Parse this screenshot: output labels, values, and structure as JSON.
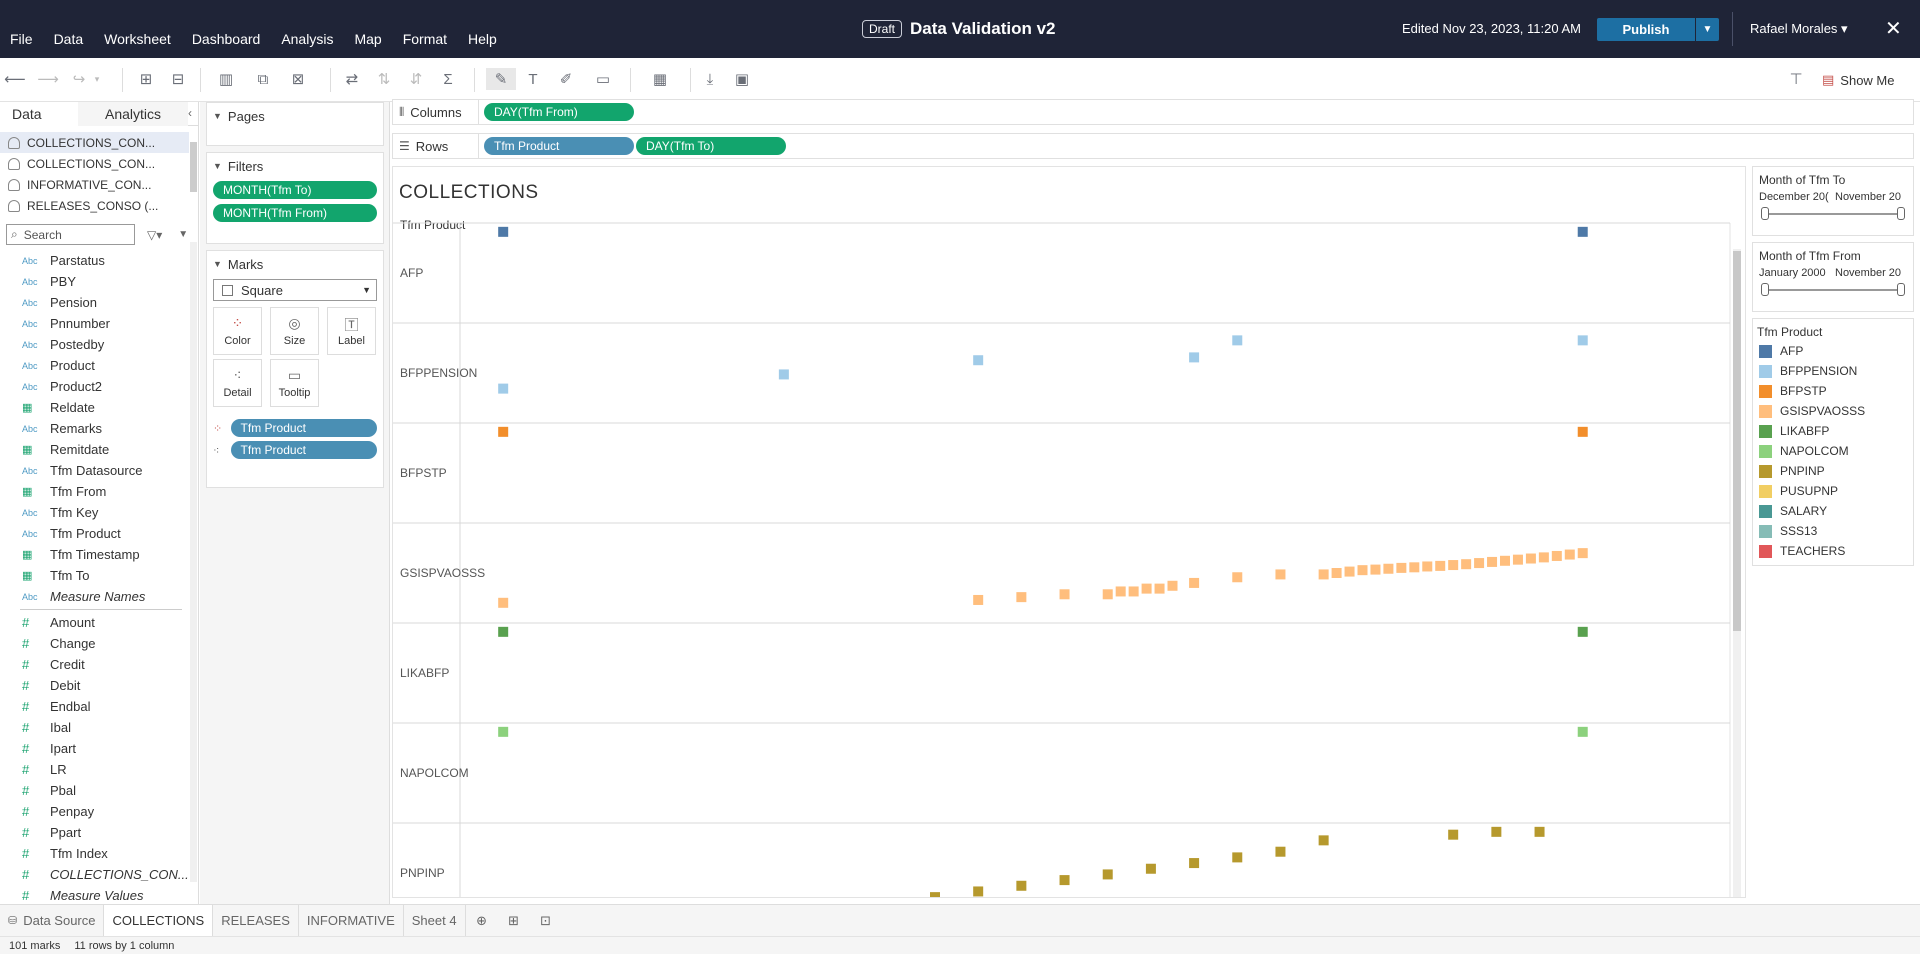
{
  "menu": [
    "File",
    "Data",
    "Worksheet",
    "Dashboard",
    "Analysis",
    "Map",
    "Format",
    "Help"
  ],
  "header": {
    "draft": "Draft",
    "title": "Data Validation v2",
    "edited": "Edited Nov 23, 2023, 11:20 AM",
    "publish": "Publish",
    "user": "Rafael Morales ▾",
    "close": "✕"
  },
  "toolbar": {
    "show_me": "Show Me"
  },
  "left_panel": {
    "tab_data": "Data",
    "tab_analytics": "Analytics",
    "datasources": [
      "COLLECTIONS_CON...",
      "COLLECTIONS_CON...",
      "INFORMATIVE_CON...",
      "RELEASES_CONSO (..."
    ],
    "search_placeholder": "Search",
    "dimensions": [
      {
        "type": "Abc",
        "name": "Parstatus"
      },
      {
        "type": "Abc",
        "name": "PBY"
      },
      {
        "type": "Abc",
        "name": "Pension"
      },
      {
        "type": "Abc",
        "name": "Pnnumber"
      },
      {
        "type": "Abc",
        "name": "Postedby"
      },
      {
        "type": "Abc",
        "name": "Product"
      },
      {
        "type": "Abc",
        "name": "Product2"
      },
      {
        "type": "date",
        "name": "Reldate"
      },
      {
        "type": "Abc",
        "name": "Remarks"
      },
      {
        "type": "date",
        "name": "Remitdate"
      },
      {
        "type": "Abc",
        "name": "Tfm Datasource"
      },
      {
        "type": "date",
        "name": "Tfm From"
      },
      {
        "type": "Abc",
        "name": "Tfm Key"
      },
      {
        "type": "Abc",
        "name": "Tfm Product"
      },
      {
        "type": "date",
        "name": "Tfm Timestamp"
      },
      {
        "type": "date",
        "name": "Tfm To"
      },
      {
        "type": "Abc",
        "name": "Measure Names",
        "italic": true
      }
    ],
    "measures": [
      {
        "name": "Amount"
      },
      {
        "name": "Change"
      },
      {
        "name": "Credit"
      },
      {
        "name": "Debit"
      },
      {
        "name": "Endbal"
      },
      {
        "name": "Ibal"
      },
      {
        "name": "Ipart"
      },
      {
        "name": "LR"
      },
      {
        "name": "Pbal"
      },
      {
        "name": "Penpay"
      },
      {
        "name": "Ppart"
      },
      {
        "name": "Tfm Index"
      },
      {
        "name": "COLLECTIONS_CON...",
        "italic": true
      },
      {
        "name": "Measure Values",
        "italic": true
      }
    ]
  },
  "cards": {
    "pages": "Pages",
    "filters": "Filters",
    "filter_pills": [
      "MONTH(Tfm To)",
      "MONTH(Tfm From)"
    ],
    "marks": "Marks",
    "mark_type": "Square",
    "mark_buttons": [
      "Color",
      "Size",
      "Label",
      "Detail",
      "Tooltip"
    ],
    "mark_pills": [
      "Tfm Product",
      "Tfm Product"
    ]
  },
  "shelves": {
    "columns_label": "Columns",
    "rows_label": "Rows",
    "columns": [
      "DAY(Tfm From)"
    ],
    "rows": [
      "Tfm Product",
      "DAY(Tfm To)"
    ]
  },
  "viz": {
    "title": "COLLECTIONS",
    "row_header": "Tfm Product"
  },
  "right": {
    "filter1": {
      "title": "Month of Tfm To",
      "from": "December 20(",
      "to": "November 20"
    },
    "filter2": {
      "title": "Month of Tfm From",
      "from": "January 2000",
      "to": "November 20"
    },
    "legend_title": "Tfm Product",
    "legend": [
      {
        "name": "AFP",
        "color": "#4e79a7"
      },
      {
        "name": "BFPPENSION",
        "color": "#a0cbe8"
      },
      {
        "name": "BFPSTP",
        "color": "#f28e2b"
      },
      {
        "name": "GSISPVAOSSS",
        "color": "#ffbe7d"
      },
      {
        "name": "LIKABFP",
        "color": "#59a14f"
      },
      {
        "name": "NAPOLCOM",
        "color": "#8cd17d"
      },
      {
        "name": "PNPINP",
        "color": "#b6992d"
      },
      {
        "name": "PUSUPNP",
        "color": "#f1ce63"
      },
      {
        "name": "SALARY",
        "color": "#499894"
      },
      {
        "name": "SSS13",
        "color": "#86bcb6"
      },
      {
        "name": "TEACHERS",
        "color": "#e15759"
      }
    ]
  },
  "sheets": {
    "datasource": "Data Source",
    "tabs": [
      "COLLECTIONS",
      "RELEASES",
      "INFORMATIVE",
      "Sheet 4"
    ],
    "active": "COLLECTIONS"
  },
  "status": {
    "marks": "101 marks",
    "dims": "11 rows by 1 column"
  },
  "chart_data": {
    "type": "scatter",
    "mark": "square",
    "title": "COLLECTIONS",
    "row_dimension": "Tfm Product",
    "x_field": "DAY(Tfm From)",
    "y_field": "DAY(Tfm To)",
    "rows": [
      {
        "name": "AFP",
        "color": "#4e79a7",
        "points": [
          [
            1,
            30
          ],
          [
            26,
            30
          ]
        ]
      },
      {
        "name": "BFPPENSION",
        "color": "#a0cbe8",
        "points": [
          [
            1,
            10
          ],
          [
            7.5,
            15
          ],
          [
            12,
            20
          ],
          [
            17,
            21
          ],
          [
            18,
            27
          ],
          [
            26,
            27
          ]
        ]
      },
      {
        "name": "BFPSTP",
        "color": "#f28e2b",
        "points": [
          [
            1,
            30
          ],
          [
            26,
            30
          ]
        ]
      },
      {
        "name": "GSISPVAOSSS",
        "color": "#ffbe7d",
        "points": [
          [
            1,
            5
          ],
          [
            12,
            6
          ],
          [
            13,
            7
          ],
          [
            14,
            8
          ],
          [
            15,
            8
          ],
          [
            15.3,
            9
          ],
          [
            15.6,
            9
          ],
          [
            15.9,
            10
          ],
          [
            16.2,
            10
          ],
          [
            16.5,
            11
          ],
          [
            17,
            12
          ],
          [
            18,
            14
          ],
          [
            19,
            15
          ],
          [
            20,
            15
          ],
          [
            20.3,
            15.5
          ],
          [
            20.6,
            16
          ],
          [
            20.9,
            16.5
          ],
          [
            21.2,
            16.7
          ],
          [
            21.5,
            17
          ],
          [
            21.8,
            17.3
          ],
          [
            22.1,
            17.5
          ],
          [
            22.4,
            17.8
          ],
          [
            22.7,
            18
          ],
          [
            23,
            18.3
          ],
          [
            23.3,
            18.6
          ],
          [
            23.6,
            19
          ],
          [
            23.9,
            19.4
          ],
          [
            24.2,
            19.8
          ],
          [
            24.5,
            20.2
          ],
          [
            24.8,
            20.6
          ],
          [
            25.1,
            21
          ],
          [
            25.4,
            21.5
          ],
          [
            25.7,
            22
          ],
          [
            26,
            22.5
          ]
        ]
      },
      {
        "name": "LIKABFP",
        "color": "#59a14f",
        "points": [
          [
            1,
            30
          ],
          [
            26,
            30
          ]
        ]
      },
      {
        "name": "NAPOLCOM",
        "color": "#8cd17d",
        "points": [
          [
            1,
            30
          ],
          [
            26,
            30
          ]
        ]
      },
      {
        "name": "PNPINP",
        "color": "#b6992d",
        "points": [
          [
            8,
            2
          ],
          [
            9,
            3
          ],
          [
            10,
            5
          ],
          [
            11,
            7
          ],
          [
            12,
            9
          ],
          [
            13,
            11
          ],
          [
            14,
            13
          ],
          [
            15,
            15
          ],
          [
            16,
            17
          ],
          [
            17,
            19
          ],
          [
            18,
            21
          ],
          [
            19,
            23
          ],
          [
            20,
            27
          ],
          [
            23,
            29
          ],
          [
            24,
            30
          ],
          [
            25,
            30
          ]
        ]
      }
    ]
  }
}
